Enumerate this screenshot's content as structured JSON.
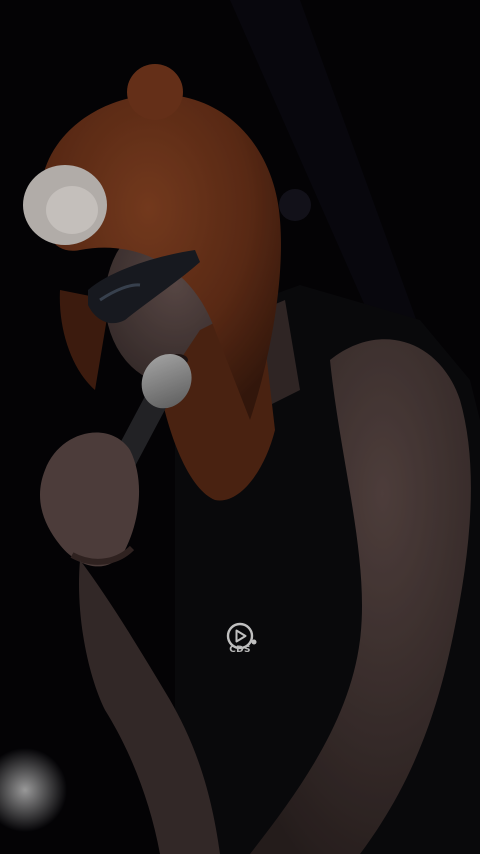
{
  "video": {
    "subject": "performer-singing",
    "colors": {
      "background": "#050407",
      "hat": "#7a3a1e",
      "skin": "#5a4845",
      "shirt": "#0c0b0e"
    }
  },
  "overlay": {
    "watermark_icon": "play-circle-icon",
    "watermark_text": "CDS"
  }
}
